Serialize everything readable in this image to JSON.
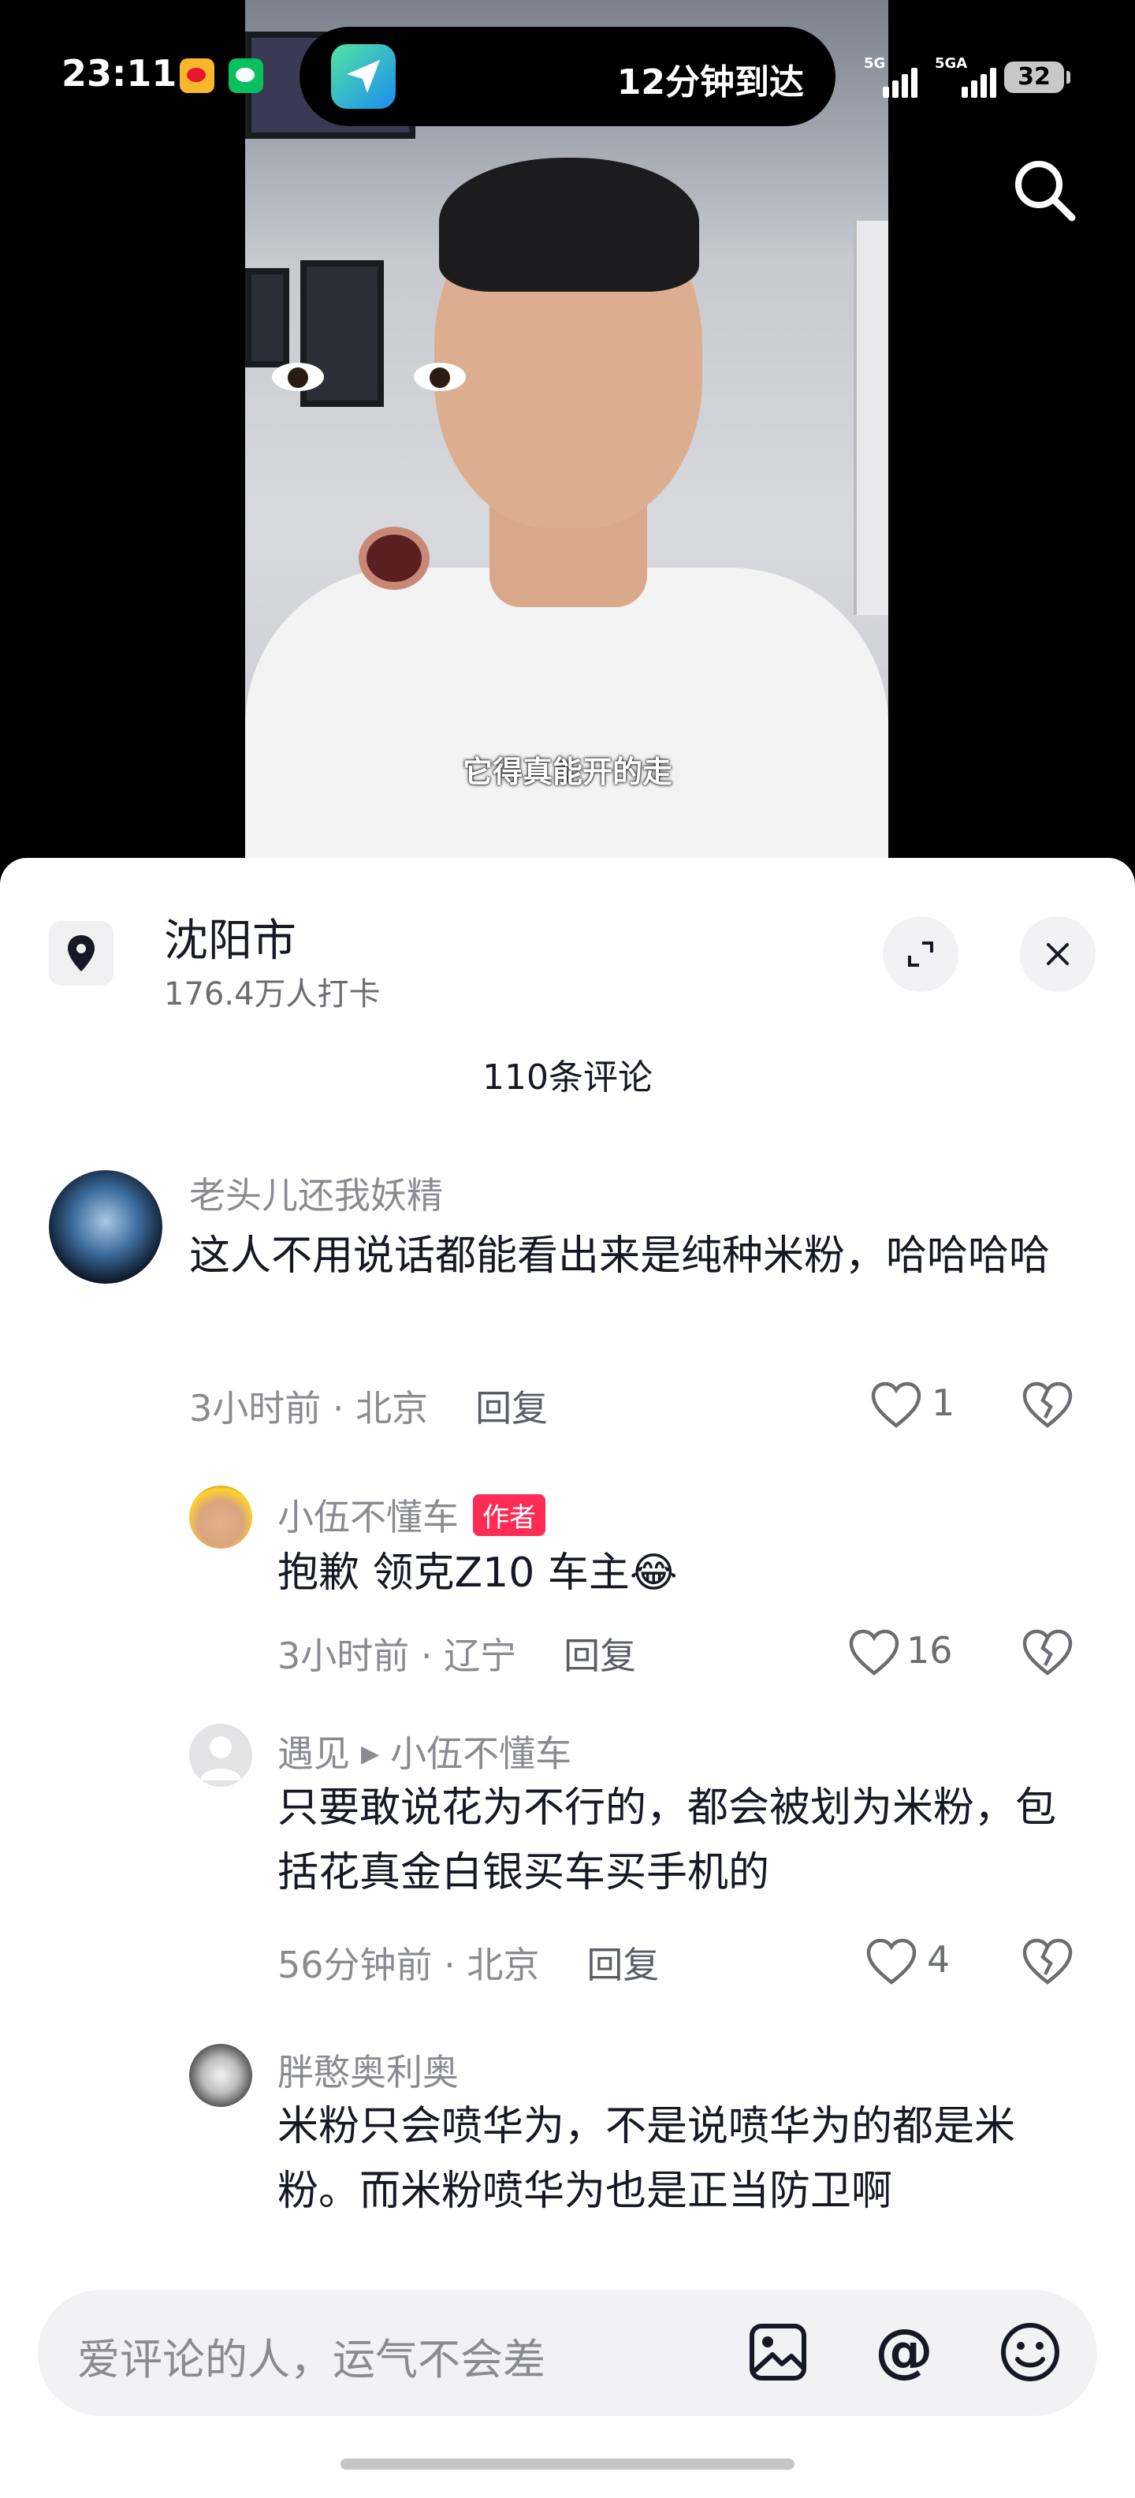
{
  "status_bar": {
    "time": "23:11",
    "island_text": "12分钟到达",
    "signal_1_label": "5G",
    "signal_2_label": "5GA",
    "battery": "32"
  },
  "video": {
    "subtitle": "它得真能开的走"
  },
  "location": {
    "city": "沈阳市",
    "checkins": "176.4万人打卡"
  },
  "comments_header": "110条评论",
  "comments": [
    {
      "user": "老头儿还我妖精",
      "text": "这人不用说话都能看出来是纯种米粉，哈哈哈哈",
      "time_location": "3小时前 · 北京",
      "reply_label": "回复",
      "likes": "1"
    },
    {
      "user": "小伍不懂车",
      "badge": "作者",
      "text": "抱歉 领克Z10 车主😂",
      "time_location": "3小时前 · 辽宁",
      "reply_label": "回复",
      "likes": "16"
    },
    {
      "user": "遇见",
      "reply_to": "小伍不懂车",
      "text": "只要敢说花为不行的，都会被划为米粉，包括花真金白银买车买手机的",
      "time_location": "56分钟前 · 北京",
      "reply_label": "回复",
      "likes": "4"
    },
    {
      "user": "胖憨奥利奥",
      "text": "米粉只会喷华为，不是说喷华为的都是米粉。而米粉喷华为也是正当防卫啊"
    }
  ],
  "input": {
    "placeholder": "爱评论的人，运气不会差"
  },
  "icons": [
    "search-icon",
    "location-pin-icon",
    "expand-icon",
    "close-icon",
    "heart-icon",
    "broken-heart-icon",
    "image-icon",
    "at-icon",
    "emoji-icon"
  ]
}
